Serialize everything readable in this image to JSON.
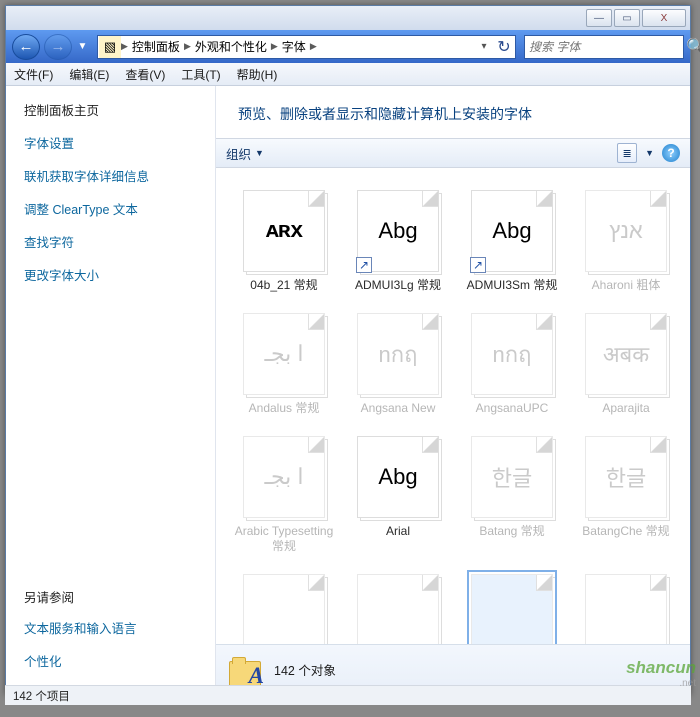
{
  "titlebar": {
    "buttons": {
      "min": "—",
      "max": "▭",
      "close": "X"
    }
  },
  "nav": {
    "back": "←",
    "fwd": "→",
    "dd": "▼"
  },
  "address": {
    "segs": [
      "控制面板",
      "外观和个性化",
      "字体"
    ],
    "sep": "▶",
    "dd": "▾",
    "refresh": "↻"
  },
  "search": {
    "placeholder": "搜索 字体",
    "icon": "🔍"
  },
  "menus": [
    "文件(F)",
    "编辑(E)",
    "查看(V)",
    "工具(T)",
    "帮助(H)"
  ],
  "sidebar": {
    "home": "控制面板主页",
    "links": [
      "字体设置",
      "联机获取字体详细信息",
      "调整 ClearType 文本",
      "查找字符",
      "更改字体大小"
    ],
    "see_also": "另请参阅",
    "see_links": [
      "文本服务和输入语言",
      "个性化"
    ]
  },
  "main": {
    "heading": "预览、删除或者显示和隐藏计算机上安装的字体",
    "toolbar": {
      "organize": "组织",
      "dd": "▼",
      "view_icon": "≣",
      "help_icon": "?"
    }
  },
  "fonts": [
    {
      "label": "04b_21 常规",
      "preview": "ᴀʀx",
      "faded": false,
      "shortcut": false,
      "class": "pixely"
    },
    {
      "label": "ADMUI3Lg 常规",
      "preview": "Abg",
      "faded": false,
      "shortcut": true
    },
    {
      "label": "ADMUI3Sm 常规",
      "preview": "Abg",
      "faded": false,
      "shortcut": true
    },
    {
      "label": "Aharoni 粗体",
      "preview": "אנץ",
      "faded": true,
      "shortcut": false
    },
    {
      "label": "Andalus 常规",
      "preview": "ا بجـ",
      "faded": true,
      "shortcut": false
    },
    {
      "label": "Angsana New",
      "preview": "nกฤ",
      "faded": true,
      "shortcut": false
    },
    {
      "label": "AngsanaUPC",
      "preview": "nกฤ",
      "faded": true,
      "shortcut": false
    },
    {
      "label": "Aparajita",
      "preview": "अबक",
      "faded": true,
      "shortcut": false
    },
    {
      "label": "Arabic Typesetting 常规",
      "preview": "ا بجـ",
      "faded": true,
      "shortcut": false
    },
    {
      "label": "Arial",
      "preview": "Abg",
      "faded": false,
      "shortcut": false
    },
    {
      "label": "Batang 常规",
      "preview": "한글",
      "faded": true,
      "shortcut": false
    },
    {
      "label": "BatangChe 常规",
      "preview": "한글",
      "faded": true,
      "shortcut": false
    },
    {
      "label": "",
      "preview": "",
      "faded": true,
      "shortcut": false
    },
    {
      "label": "",
      "preview": "",
      "faded": true,
      "shortcut": false
    },
    {
      "label": "",
      "preview": "",
      "faded": true,
      "shortcut": false,
      "sel": true
    },
    {
      "label": "",
      "preview": "",
      "faded": true,
      "shortcut": false
    }
  ],
  "details": {
    "count": "142 个对象"
  },
  "status": {
    "text": "142 个项目"
  },
  "watermark": {
    "main": "shancun",
    "sub": ".net"
  }
}
